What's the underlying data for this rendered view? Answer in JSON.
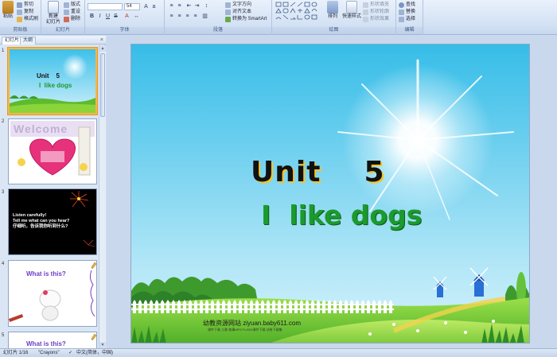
{
  "ribbon": {
    "clipboard": {
      "paste": "粘贴",
      "cut": "剪切",
      "copy": "复制",
      "format_painter": "格式刷",
      "label": "剪贴板"
    },
    "slides": {
      "new_slide": "新建\n幻灯片",
      "layout": "版式",
      "reset": "重设",
      "delete": "删除",
      "label": "幻灯片"
    },
    "font": {
      "font_name": "",
      "font_size": "54",
      "label": "字体"
    },
    "paragraph": {
      "text_direction": "文字方向",
      "align_text": "对齐文本",
      "smartart": "转换为 SmartArt",
      "label": "段落"
    },
    "drawing": {
      "arrange": "排列",
      "quick_styles": "快速样式",
      "shape_fill": "形状填充",
      "shape_outline": "形状轮廓",
      "shape_effects": "形状效果",
      "label": "绘图"
    },
    "editing": {
      "find": "查找",
      "replace": "替换",
      "select": "选择",
      "label": "编辑"
    }
  },
  "pane": {
    "tabs": [
      "幻灯片",
      "大纲"
    ],
    "close_glyph": "×",
    "slides": [
      {
        "number": "1",
        "title": "Unit    5",
        "subtitle": "I  like dogs"
      },
      {
        "number": "2",
        "title": "Welcome"
      },
      {
        "number": "3",
        "lines": [
          "Listen carefully!",
          "Tell me what can you hear?",
          "仔细听，告诉我你听到什么?"
        ]
      },
      {
        "number": "4",
        "title": "What is this?"
      },
      {
        "number": "5",
        "title": "What is this?"
      }
    ]
  },
  "slide": {
    "title": "Unit    5",
    "subtitle": "I  like dogs",
    "watermark": "幼教资源网站  ziyuan.baby611.com",
    "watermark_small": "课件下载    儿歌    故事MP3    FLASH课件下载    试卷下载集"
  },
  "status": {
    "slide_index": "幻灯片 1/16",
    "theme": "\"Crayons\"",
    "language": "中文(简体，中国)"
  },
  "colors": {
    "title_shadow": "#f5c322",
    "subtitle": "#1c9a2d",
    "selected_border": "#f3b74b"
  }
}
